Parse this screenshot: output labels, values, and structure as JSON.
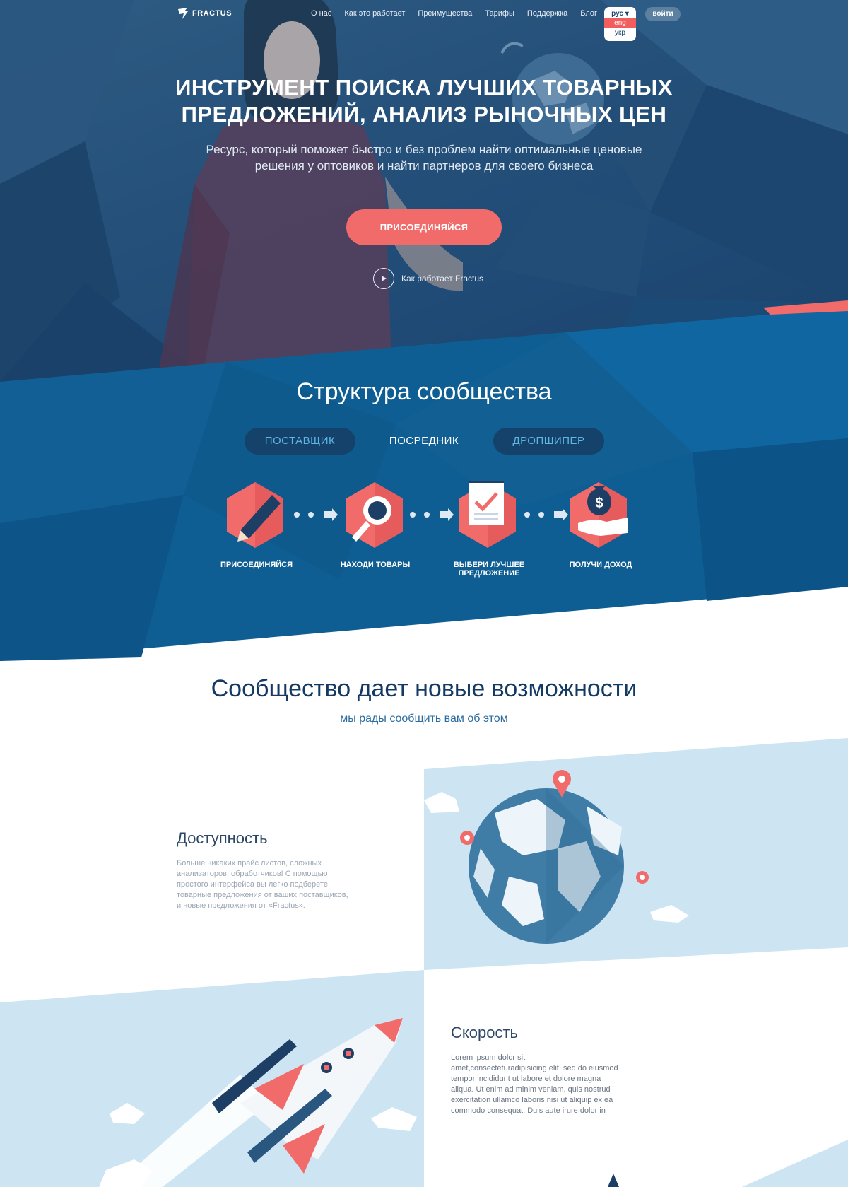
{
  "brand": {
    "name": "FRACTUS"
  },
  "nav": {
    "links": [
      "О нас",
      "Как это работает",
      "Преимущества",
      "Тарифы",
      "Поддержка",
      "Блог"
    ],
    "language": {
      "current": "рус",
      "options": [
        "eng",
        "укр"
      ]
    },
    "login_label": "войти"
  },
  "hero": {
    "title_line1": "ИНСТРУМЕНТ ПОИСКА ЛУЧШИХ ТОВАРНЫХ",
    "title_line2": "ПРЕДЛОЖЕНИЙ, АНАЛИЗ РЫНОЧНЫХ ЦЕН",
    "subtitle_line1": "Ресурс, который поможет быстро и без проблем найти оптимальные ценовые",
    "subtitle_line2": "решения у оптовиков и найти партнеров для своего бизнеса",
    "cta_label": "ПРИСОЕДИНЯЙСЯ",
    "video_label": "Как работает Fractus"
  },
  "structure": {
    "title": "Структура сообщества",
    "tabs": [
      "ПОСТАВЩИК",
      "ПОСРЕДНИК",
      "ДРОПШИПЕР"
    ],
    "steps": [
      "ПРИСОЕДИНЯЙСЯ",
      "НАХОДИ ТОВАРЫ",
      "ВЫБЕРИ ЛУЧШЕЕ ПРЕДЛОЖЕНИЕ",
      "ПОЛУЧИ ДОХОД"
    ]
  },
  "community": {
    "title": "Сообщество дает новые возможности",
    "subtitle": "мы рады сообщить вам об этом",
    "features": [
      {
        "title": "Доступность",
        "text_lines": [
          "Больше никаких прайс листов, сложных",
          "анализаторов, обработчиков! С помощью",
          "простого интерфейса вы легко подберете",
          "товарные предложения от ваших поставщиков,",
          "и новые предложения от «Fractus»."
        ]
      },
      {
        "title": "Скорость",
        "text_lines": [
          "Lorem ipsum dolor sit",
          "amet,consecteturadipisicing elit, sed do eiusmod",
          "tempor incididunt ut labore et dolore magna",
          "aliqua. Ut enim ad minim veniam, quis nostrud",
          "exercitation ullamco laboris nisi ut aliquip ex ea",
          "commodo consequat. Duis aute irure dolor in"
        ]
      }
    ]
  },
  "colors": {
    "accent": "#f26b6b",
    "hero_blue": "#24507a",
    "structure_blue": "#0f5e93",
    "light_blue": "#cde5f3",
    "heading_navy": "#143a63"
  }
}
